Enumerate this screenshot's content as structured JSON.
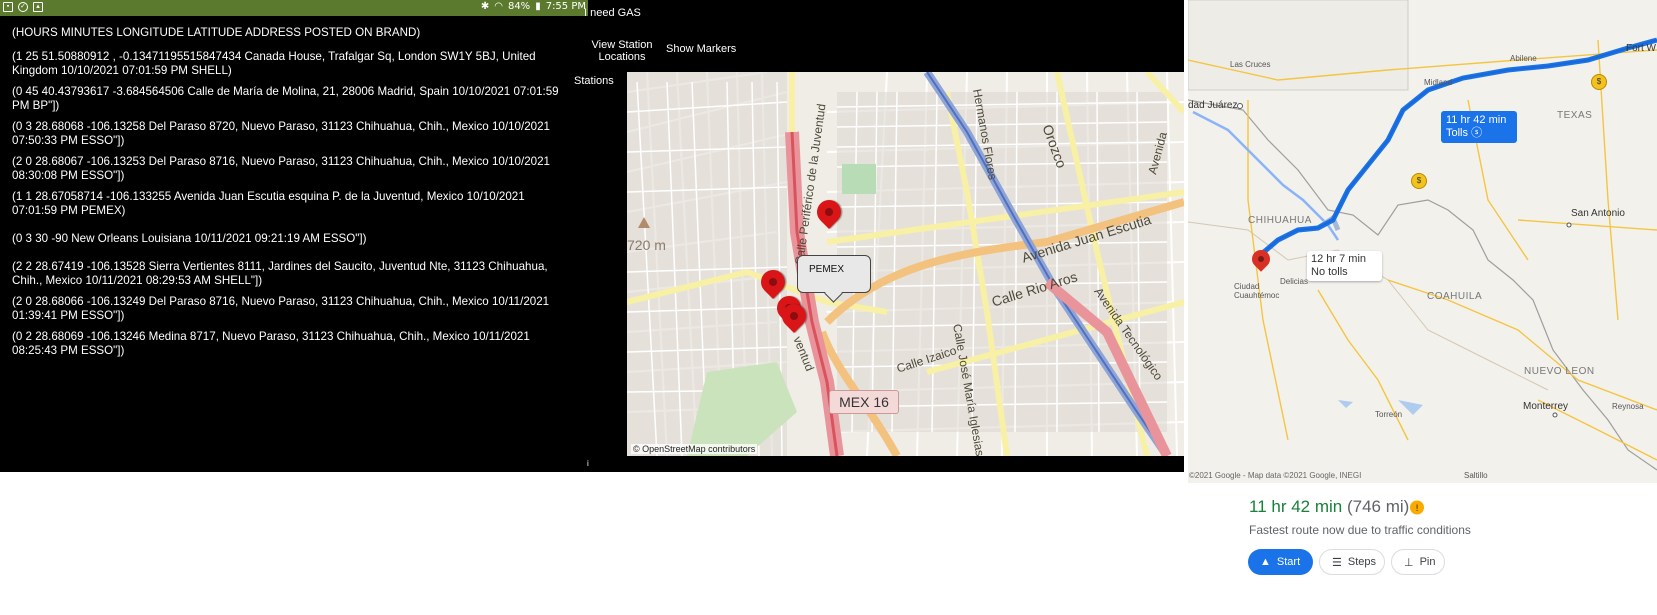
{
  "status_bar": {
    "battery": "84%",
    "time": "7:55 PM"
  },
  "records": {
    "header": "(HOURS MINUTES LONGITUDE LATITUDE ADDRESS POSTED ON BRAND)",
    "items": [
      "(1 25 51.50880912 , -0.13471195515847434 Canada House, Trafalgar Sq, London SW1Y 5BJ, United Kingdom 10/10/2021 07:01:59 PM SHELL)",
      "(0 45 40.43793617 -3.684564506 Calle de María de Molina, 21, 28006 Madrid, Spain 10/10/2021 07:01:59 PM BP\"])",
      "(0 3 28.68068 -106.13258 Del Paraso 8720, Nuevo Paraso, 31123 Chihuahua, Chih., Mexico 10/10/2021 07:50:33 PM ESSO\"])",
      "(2 0 28.68067 -106.13253 Del Paraso 8716, Nuevo Paraso, 31123 Chihuahua, Chih., Mexico 10/10/2021 08:30:08 PM ESSO\"])",
      "(1 1 28.67058714 -106.133255 Avenida Juan Escutia esquina P. de la Juventud, Mexico 10/10/2021 07:01:59 PM PEMEX)",
      "(0 3 30 -90 New Orleans Louisiana 10/11/2021 09:21:19 AM ESSO\"])",
      "(2 2 28.67419 -106.13528 Sierra Vertientes 8111, Jardines del Saucito, Juventud Nte, 31123 Chihuahua, Chih., Mexico 10/11/2021 08:29:53 AM SHELL\"])",
      "(2 0 28.68066 -106.13249 Del Paraso 8716, Nuevo Paraso, 31123 Chihuahua, Chih., Mexico 10/11/2021 01:39:41 PM ESSO\"])",
      "(0 2 28.68069 -106.13246 Medina 8717, Nuevo Paraso, 31123 Chihuahua, Chih., Mexico 10/11/2021 08:25:43 PM ESSO\"])"
    ]
  },
  "app_bar": {
    "need_gas": "I need GAS",
    "view_station_locations": "View Station Locations",
    "show_markers": "Show Markers",
    "stations": "Stations",
    "info_glyph": "i"
  },
  "osm_map": {
    "elevation": "720 m",
    "attribution": "© OpenStreetMap contributors",
    "callout": "PEMEX",
    "shield": "MEX 16",
    "street_labels": {
      "periferico": "Calle Periférico de la Juventud",
      "orozco": "Orozco",
      "flores": "Hermanos Flores",
      "avenida": "Avenida",
      "juan_escutia": "Avenida Juan Escutia",
      "rio_aros": "Calle Rio Aros",
      "tecnologico": "Avenida Tecnológico",
      "izaico": "Calle Izaico",
      "jose_maria": "Calle José María Iglesias",
      "ventud": "ventud"
    }
  },
  "google_map": {
    "labels": {
      "las_cruces": "Las Cruces",
      "abilene": "Abilene",
      "fort_worth": "Fort W",
      "ciudad_juarez": "dad Juárez",
      "midland": "Midland",
      "texas": "TEXAS",
      "chihuahua": "CHIHUAHUA",
      "san_antonio": "San Antonio",
      "ciudad_cuauhtemoc": "Ciudad Cuauhtémoc",
      "delicias": "Delicias",
      "coahuila": "COAHUILA",
      "nuevo_leon": "NUEVO LEON",
      "monterrey": "Monterrey",
      "torreon": "Torreón",
      "reynosa": "Reynosa",
      "saltillo": "Saltillo"
    },
    "route_badge": {
      "time": "11 hr 42 min",
      "note": "Tolls"
    },
    "alt_badge": {
      "time": "12 hr 7 min",
      "note": "No tolls"
    },
    "attribution": "©2021 Google - Map data ©2021 Google, INEGI"
  },
  "route_sheet": {
    "duration": "11 hr 42 min",
    "distance": "(746 mi)",
    "description": "Fastest route now due to traffic conditions",
    "buttons": {
      "start": "Start",
      "steps": "Steps",
      "pin": "Pin"
    }
  }
}
